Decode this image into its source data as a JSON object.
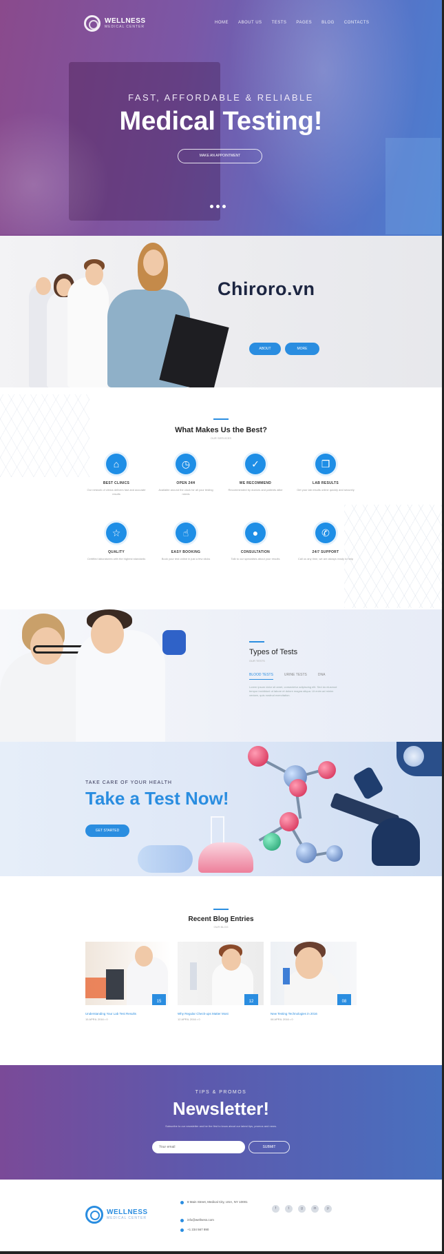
{
  "brand": {
    "name": "WELLNESS",
    "tagline": "MEDICAL CENTER",
    "watermark": "Chiroro.vn"
  },
  "nav": {
    "items": [
      "HOME",
      "ABOUT US",
      "TESTS",
      "PAGES",
      "BLOG",
      "CONTACTS"
    ]
  },
  "hero": {
    "kicker": "FAST, AFFORDABLE & RELIABLE",
    "title": "Medical Testing!",
    "button": "MAKE AN APPOINTMENT"
  },
  "team": {
    "buttons": [
      "ABOUT",
      "MORE"
    ]
  },
  "features": {
    "title": "What Makes Us the Best?",
    "subtitle": "OUR SERVICES",
    "items": [
      {
        "icon": "building-icon",
        "glyph": "⌂",
        "title": "BEST CLINICS",
        "text": "Our network of clinics delivers fast and accurate results"
      },
      {
        "icon": "clock-icon",
        "glyph": "◷",
        "title": "OPEN 24H",
        "text": "Available around the clock for all your testing needs"
      },
      {
        "icon": "like-icon",
        "glyph": "✓",
        "title": "WE RECOMMEND",
        "text": "Recommended by doctors and patients alike"
      },
      {
        "icon": "document-icon",
        "glyph": "❒",
        "title": "LAB RESULTS",
        "text": "Get your lab results online quickly and securely"
      },
      {
        "icon": "star-icon",
        "glyph": "☆",
        "title": "QUALITY",
        "text": "Certified laboratories with the highest standards"
      },
      {
        "icon": "touch-icon",
        "glyph": "☝",
        "title": "EASY BOOKING",
        "text": "Book your test online in just a few clicks"
      },
      {
        "icon": "user-icon",
        "glyph": "●",
        "title": "CONSULTATION",
        "text": "Talk to our specialists about your results"
      },
      {
        "icon": "phone-icon",
        "glyph": "✆",
        "title": "24/7 SUPPORT",
        "text": "Call us any time, we are always ready to help"
      }
    ]
  },
  "tests": {
    "title": "Types of Tests",
    "subtitle": "OUR TESTS",
    "tabs": [
      "BLOOD TESTS",
      "URINE TESTS",
      "DNA"
    ],
    "text": "Lorem ipsum dolor sit amet, consectetur adipiscing elit. Sed do eiusmod tempor incididunt ut labore et dolore magna aliqua. Ut enim ad minim veniam, quis nostrud exercitation."
  },
  "cta": {
    "kicker": "TAKE CARE OF YOUR HEALTH",
    "title": "Take a Test Now!",
    "button": "GET STARTED"
  },
  "blog": {
    "title": "Recent Blog Entries",
    "subtitle": "OUR BLOG",
    "posts": [
      {
        "title": "Understanding Your Lab Test Results",
        "meta": "15 APRIL 2016 • 0",
        "badge": "15"
      },
      {
        "title": "Why Regular Check-ups Matter Most",
        "meta": "12 APRIL 2016 • 0",
        "badge": "12"
      },
      {
        "title": "New Testing Technologies in 2016",
        "meta": "08 APRIL 2016 • 0",
        "badge": "08"
      }
    ]
  },
  "newsletter": {
    "kicker": "TIPS & PROMOS",
    "title": "Newsletter!",
    "text": "Subscribe to our newsletter and be the first to know about our latest tips, promos and news.",
    "placeholder": "Your email",
    "button": "SUBMIT"
  },
  "footer": {
    "address": "8 Main Street, Medical City, USA, NY 10001",
    "email": "info@wellness.com",
    "phone": "+1 234 567 890",
    "socials": [
      "f",
      "t",
      "g",
      "in",
      "p"
    ]
  },
  "colors": {
    "accent": "#2a8de0",
    "hero_start": "#8a4a8c",
    "hero_end": "#4a7fd0",
    "dark_text": "#1c2541"
  }
}
